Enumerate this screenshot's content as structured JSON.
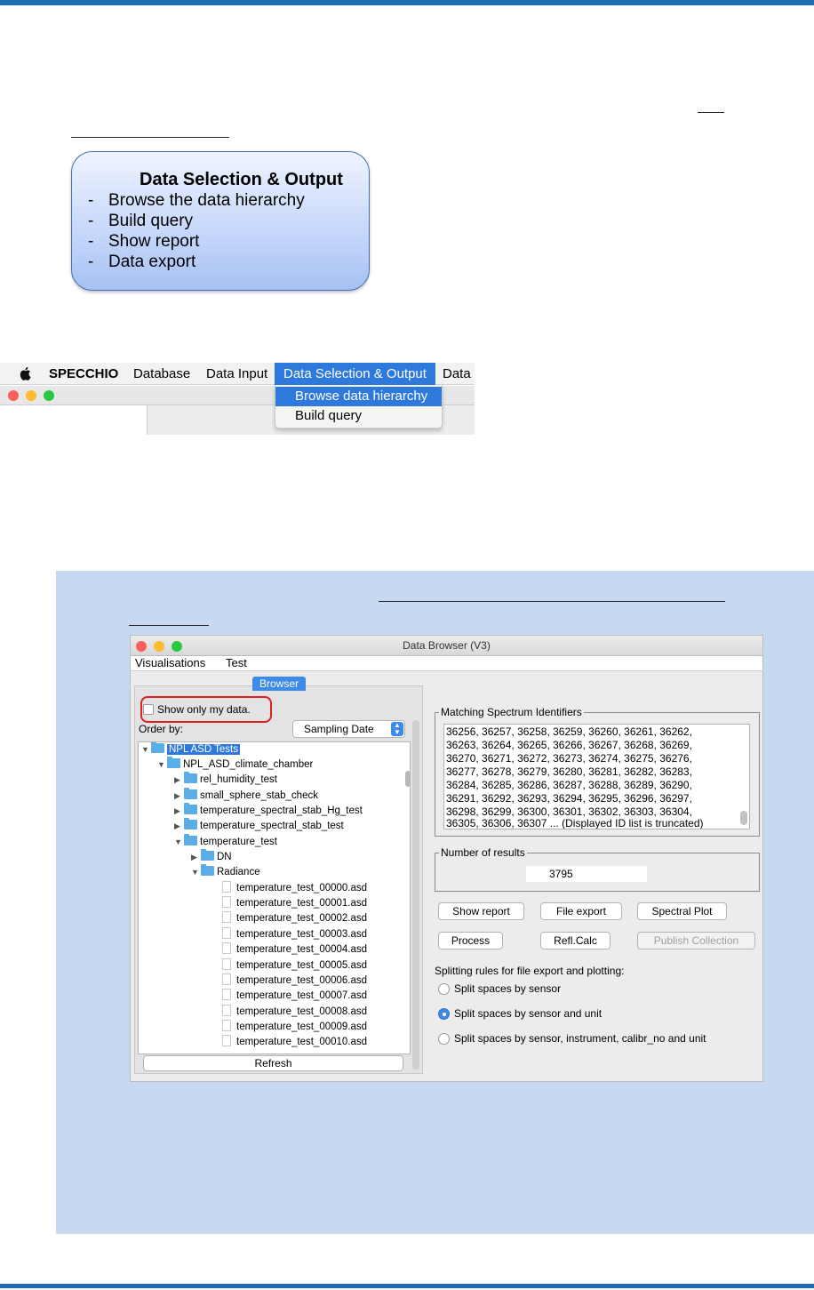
{
  "callout": {
    "title": "Data Selection & Output",
    "items": [
      "Browse the data hierarchy",
      "Build query",
      "Show report",
      "Data export"
    ],
    "bullet": "-"
  },
  "mac_menu": {
    "apple_icon": "apple-icon",
    "app_name": "SPECCHIO",
    "items": [
      "Database",
      "Data Input",
      "Data Selection & Output",
      "Data"
    ],
    "dropdown": [
      "Browse data hierarchy",
      "Build query"
    ]
  },
  "colors": {
    "accent": "#1f6fb4",
    "panel": "#c7d9f1",
    "selection": "#2e79dc",
    "highlight_box": "#e02020"
  },
  "data_browser": {
    "title": "Data Browser (V3)",
    "menu": [
      "Visualisations",
      "Test"
    ],
    "tab": "Browser",
    "show_only_my_data": "Show only my data.",
    "order_by_label": "Order by:",
    "order_by_value": "Sampling Date",
    "tree": [
      {
        "label": "NPL ASD Tests",
        "type": "folder",
        "expanded": true,
        "selected": true
      },
      {
        "label": "NPL_ASD_climate_chamber",
        "type": "folder",
        "expanded": true
      },
      {
        "label": "rel_humidity_test",
        "type": "folder",
        "expanded": false
      },
      {
        "label": "small_sphere_stab_check",
        "type": "folder",
        "expanded": false
      },
      {
        "label": "temperature_spectral_stab_Hg_test",
        "type": "folder",
        "expanded": false
      },
      {
        "label": "temperature_spectral_stab_test",
        "type": "folder",
        "expanded": false
      },
      {
        "label": "temperature_test",
        "type": "folder",
        "expanded": true
      },
      {
        "label": "DN",
        "type": "folder",
        "expanded": false
      },
      {
        "label": "Radiance",
        "type": "folder",
        "expanded": true
      },
      {
        "label": "temperature_test_00000.asd",
        "type": "file"
      },
      {
        "label": "temperature_test_00001.asd",
        "type": "file"
      },
      {
        "label": "temperature_test_00002.asd",
        "type": "file"
      },
      {
        "label": "temperature_test_00003.asd",
        "type": "file"
      },
      {
        "label": "temperature_test_00004.asd",
        "type": "file"
      },
      {
        "label": "temperature_test_00005.asd",
        "type": "file"
      },
      {
        "label": "temperature_test_00006.asd",
        "type": "file"
      },
      {
        "label": "temperature_test_00007.asd",
        "type": "file"
      },
      {
        "label": "temperature_test_00008.asd",
        "type": "file"
      },
      {
        "label": "temperature_test_00009.asd",
        "type": "file"
      },
      {
        "label": "temperature_test_00010.asd",
        "type": "file"
      }
    ],
    "refresh": "Refresh",
    "matching_label": "Matching Spectrum Identifiers",
    "matching_ids": [
      "36256, 36257, 36258, 36259, 36260, 36261, 36262,",
      "36263, 36264, 36265, 36266, 36267, 36268, 36269,",
      "36270, 36271, 36272, 36273, 36274, 36275, 36276,",
      "36277, 36278, 36279, 36280, 36281, 36282, 36283,",
      "36284, 36285, 36286, 36287, 36288, 36289, 36290,",
      "36291, 36292, 36293, 36294, 36295, 36296, 36297,",
      "36298, 36299, 36300, 36301, 36302, 36303, 36304,",
      "36305, 36306, 36307 ... (Displayed ID list is truncated)"
    ],
    "results_label": "Number of results",
    "results_value": "3795",
    "buttons": {
      "show_report": "Show report",
      "file_export": "File export",
      "spectral_plot": "Spectral Plot",
      "process": "Process",
      "refl_calc": "Refl.Calc",
      "publish_collection": "Publish Collection"
    },
    "splitting_label": "Splitting rules for file export and plotting:",
    "radios": [
      {
        "label": "Split spaces by sensor",
        "checked": false
      },
      {
        "label": "Split spaces by sensor and unit",
        "checked": true
      },
      {
        "label": "Split spaces by sensor, instrument, calibr_no and unit",
        "checked": false
      }
    ]
  }
}
